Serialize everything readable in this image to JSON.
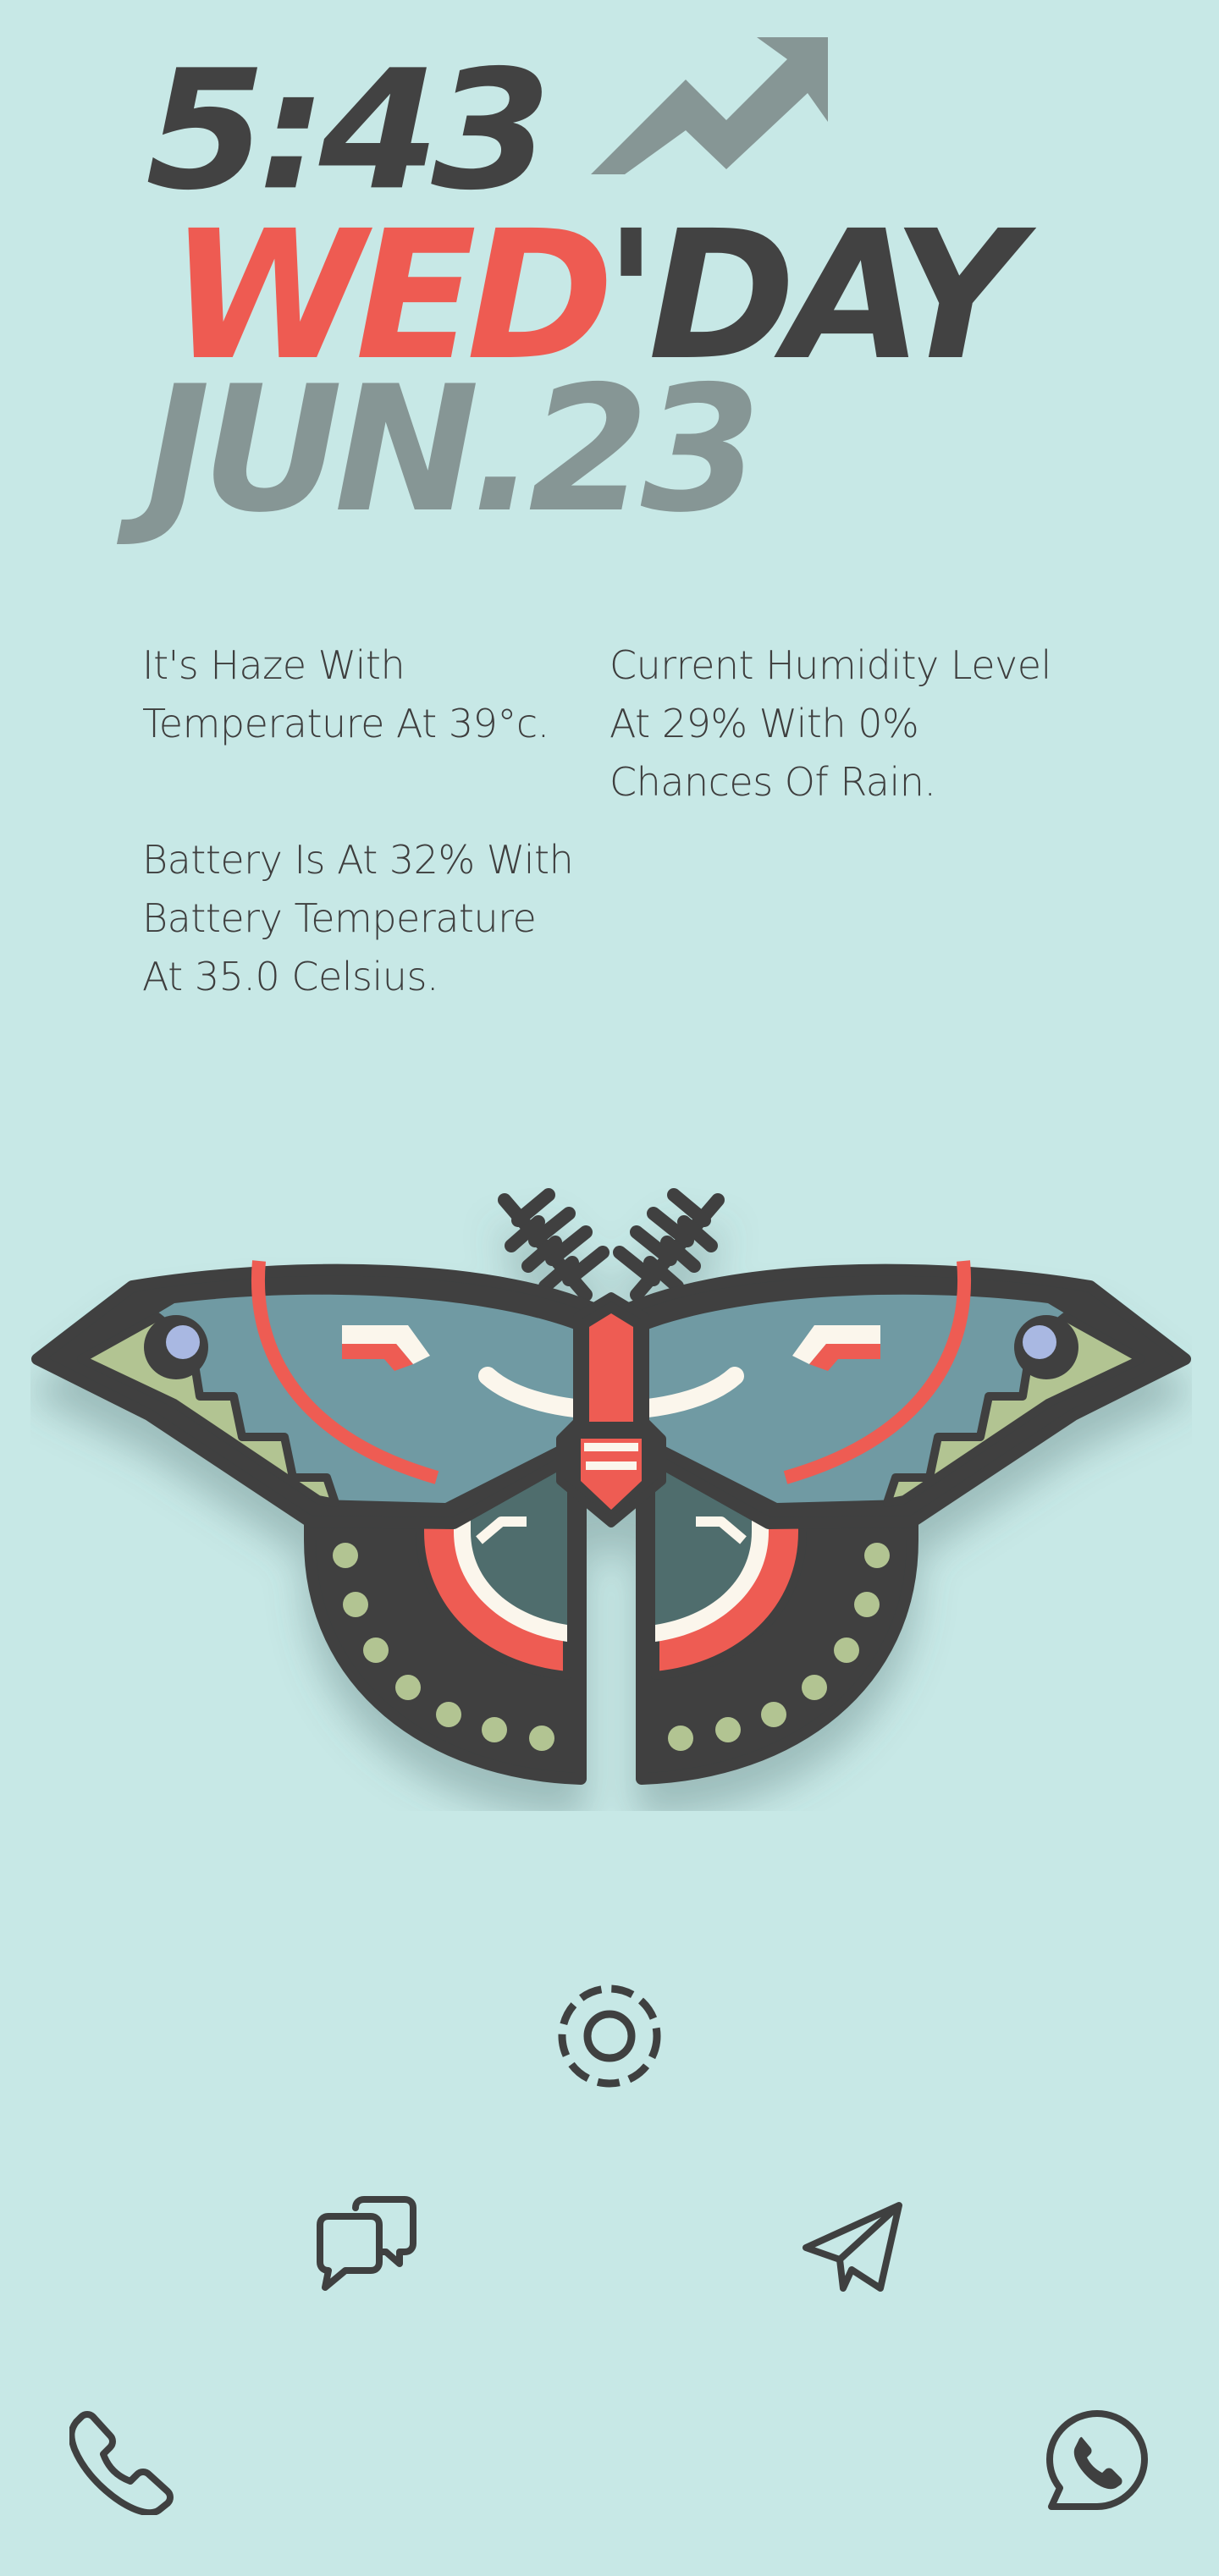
{
  "clock": {
    "time": "5:43",
    "day_part1": "WED",
    "day_part2": "'DAY",
    "date": "JUN.23"
  },
  "info": {
    "weather_lines": [
      "It's Haze With",
      "Temperature At 39°c."
    ],
    "humidity_lines": [
      "Current Humidity Level",
      "At 29% With 0%",
      "Chances Of Rain."
    ],
    "battery_lines": [
      "Battery Is At 32% With",
      "Battery Temperature",
      "At 35.0 Celsius."
    ]
  },
  "colors": {
    "background": "#c7e8e6",
    "dark": "#424242",
    "accent_red": "#ee5b52",
    "muted_gray": "#869695",
    "moth_teal": "#6f9aa3",
    "moth_dark_teal": "#4f6d6d",
    "moth_green": "#b2c492",
    "moth_blue": "#a9b8e2"
  },
  "icons": {
    "trend": "trending-up-icon",
    "moth": "moth-illustration",
    "camera": "camera-icon",
    "chat": "chat-icon",
    "send": "send-icon",
    "phone": "phone-icon",
    "whatsapp": "whatsapp-icon"
  }
}
